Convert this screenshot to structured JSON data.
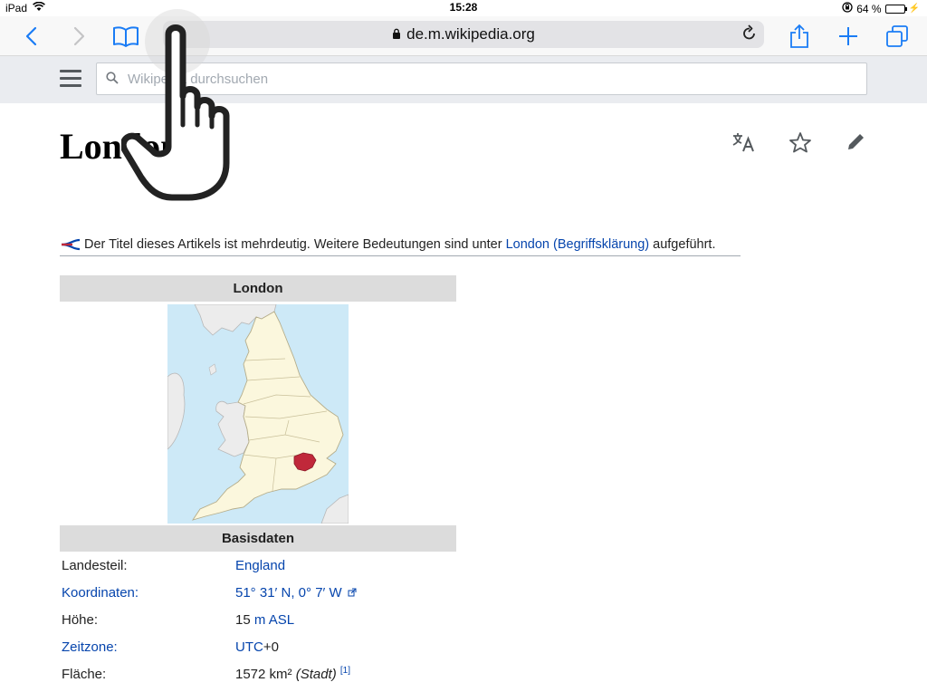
{
  "status": {
    "device": "iPad",
    "time": "15:28",
    "battery": "64 %",
    "battery_level": 0.64
  },
  "toolbar": {
    "url": "de.m.wikipedia.org"
  },
  "search": {
    "placeholder": "Wikipedia durchsuchen"
  },
  "page": {
    "title": "London"
  },
  "hatnote": {
    "text_before": "Der Titel dieses Artikels ist mehrdeutig. Weitere Bedeutungen sind unter ",
    "link": "London (Begriffsklärung)",
    "text_after": " aufgeführt."
  },
  "infobox": {
    "title": "London",
    "section": "Basisdaten",
    "rows": [
      {
        "key": "Landesteil:",
        "value_link": "England"
      },
      {
        "key_link": "Koordinaten:",
        "value_link": "51° 31′ N, 0° 7′ W"
      },
      {
        "key": "Höhe:",
        "value_prefix": "15 ",
        "value_link": "m ASL"
      },
      {
        "key_link": "Zeitzone:",
        "value_link": "UTC",
        "value_suffix": "+0"
      },
      {
        "key": "Fläche:",
        "value_prefix": "1572 km² ",
        "value_italic": "(Stadt)",
        "value_ref": "[1]"
      }
    ]
  },
  "colors": {
    "ios_blue": "#1a7cf5",
    "link": "#0645ad",
    "london_red": "#c0283a",
    "sea": "#cde9f7",
    "land": "#fbf7dd"
  },
  "icons": {
    "back": "chevron-left-icon",
    "forward": "chevron-right-icon",
    "bookmarks": "book-icon",
    "reader": "reader-icon",
    "share": "share-icon",
    "new_tab": "plus-icon",
    "tabs": "tabs-icon",
    "translate": "translate-icon",
    "watch": "star-icon",
    "edit": "pencil-icon"
  }
}
